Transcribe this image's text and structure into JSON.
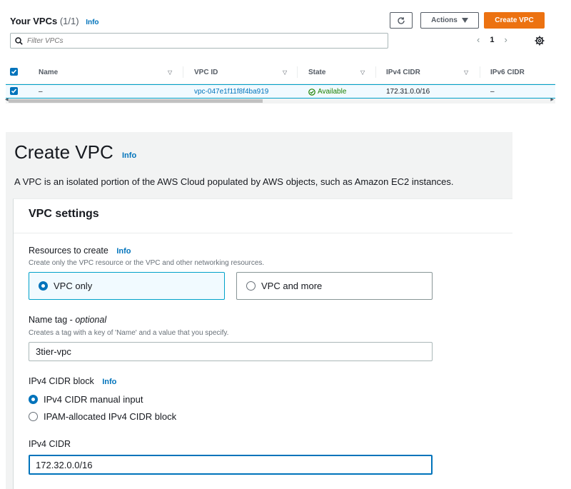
{
  "vpc_list": {
    "title": "Your VPCs",
    "count": "(1/1)",
    "info": "Info",
    "actions_label": "Actions",
    "create_label": "Create VPC",
    "filter_placeholder": "Filter VPCs",
    "page": "1",
    "columns": [
      "Name",
      "VPC ID",
      "State",
      "IPv4 CIDR",
      "IPv6 CIDR"
    ],
    "row": {
      "name": "–",
      "vpc_id": "vpc-047e1f11f8f4ba919",
      "state": "Available",
      "ipv4_cidr": "172.31.0.0/16",
      "ipv6_cidr": "–"
    }
  },
  "create_vpc": {
    "title": "Create VPC",
    "info": "Info",
    "description": "A VPC is an isolated portion of the AWS Cloud populated by AWS objects, such as Amazon EC2 instances.",
    "settings_title": "VPC settings",
    "resources": {
      "label": "Resources to create",
      "info": "Info",
      "description": "Create only the VPC resource or the VPC and other networking resources.",
      "option_vpc_only": "VPC only",
      "option_vpc_and_more": "VPC and more",
      "selected": "VPC only"
    },
    "name_tag": {
      "label": "Name tag - ",
      "optional": "optional",
      "description": "Creates a tag with a key of 'Name' and a value that you specify.",
      "value": "3tier-vpc"
    },
    "ipv4_block": {
      "label": "IPv4 CIDR block",
      "info": "Info",
      "option_manual": "IPv4 CIDR manual input",
      "option_ipam": "IPAM-allocated IPv4 CIDR block",
      "selected": "IPv4 CIDR manual input"
    },
    "ipv4_cidr": {
      "label": "IPv4 CIDR",
      "value": "172.32.0.0/16"
    }
  },
  "colors": {
    "accent": "#0073bb",
    "primary_button": "#ec7211",
    "success": "#1d8102",
    "selected_bg": "#f1faff"
  },
  "icons": [
    "search-icon",
    "refresh-icon",
    "caret-down-icon",
    "chevron-left-icon",
    "chevron-right-icon",
    "settings-icon",
    "checkbox-checked-icon",
    "sort-icon",
    "status-ok-icon"
  ]
}
